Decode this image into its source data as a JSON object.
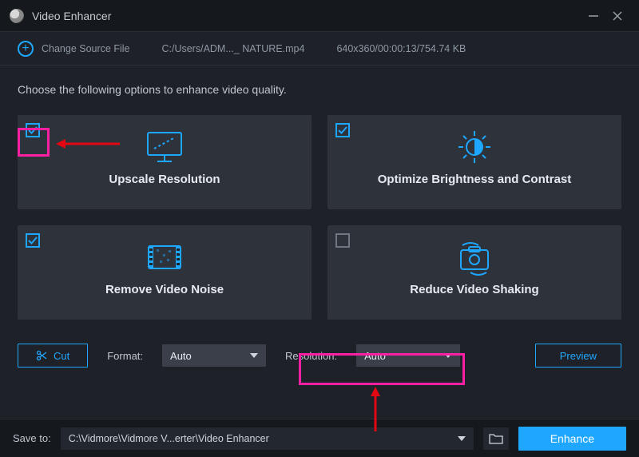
{
  "titlebar": {
    "title": "Video Enhancer"
  },
  "sourcebar": {
    "change_label": "Change Source File",
    "path": "C:/Users/ADM..._ NATURE.mp4",
    "meta": "640x360/00:00:13/754.74 KB"
  },
  "main": {
    "instruction": "Choose the following options to enhance video quality.",
    "cards": {
      "upscale": {
        "label": "Upscale Resolution",
        "checked": true
      },
      "optimize": {
        "label": "Optimize Brightness and Contrast",
        "checked": true
      },
      "noise": {
        "label": "Remove Video Noise",
        "checked": true
      },
      "shaking": {
        "label": "Reduce Video Shaking",
        "checked": false
      }
    }
  },
  "controls": {
    "cut_label": "Cut",
    "format_label": "Format:",
    "format_value": "Auto",
    "resolution_label": "Resolution:",
    "resolution_value": "Auto",
    "preview_label": "Preview"
  },
  "bottombar": {
    "saveto_label": "Save to:",
    "path": "C:\\Vidmore\\Vidmore V...erter\\Video Enhancer",
    "enhance_label": "Enhance"
  }
}
